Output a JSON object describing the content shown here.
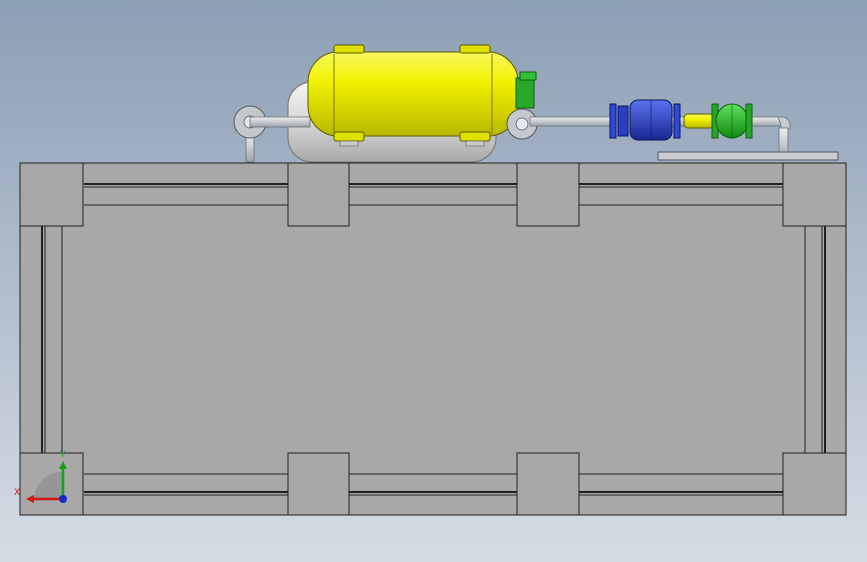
{
  "view": {
    "background_top": "#8c9fb4",
    "background_bottom": "#d6dce5"
  },
  "model": {
    "tank_color": "#f2f200",
    "frame_color": "#a8a8a8",
    "pump_color": "#2a3fc0",
    "valve_color": "#1eb21e",
    "pipe_color": "#c8ccd0"
  },
  "triad": {
    "x_label": "X",
    "y_label": "Y",
    "x_color": "#d01818",
    "y_color": "#18a018",
    "z_color": "#1828c8"
  }
}
